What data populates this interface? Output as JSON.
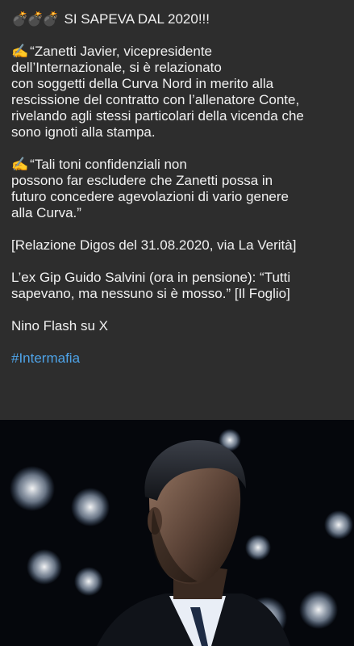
{
  "post": {
    "header": {
      "bombs": "💣💣💣",
      "title": "SI SAPEVA DAL 2020!!!"
    },
    "quote1": {
      "emoji": "✍️",
      "lines": [
        "“Zanetti Javier, vicepresidente",
        "dell’Internazionale, si è relazionato",
        "con soggetti della Curva Nord in merito alla",
        "rescissione del contratto con l’allenatore Conte,",
        "rivelando agli stessi particolari della vicenda che",
        "sono ignoti alla stampa."
      ]
    },
    "quote2": {
      "emoji": "✍️",
      "lines": [
        "“Tali toni confidenziali non",
        "possono far escludere che Zanetti possa in",
        "futuro concedere agevolazioni di vario genere",
        "alla Curva.”"
      ]
    },
    "source": "[Relazione Digos del 31.08.2020, via La Verità]",
    "gip": [
      "L’ex Gip Guido Salvini (ora in pensione): “Tutti",
      "sapevano, ma nessuno si è mosso.” [Il Foglio]"
    ],
    "author": "Nino Flash su X",
    "hashtag": "#Intermafia"
  },
  "colors": {
    "background": "#2d2d2d",
    "text": "#f1f1f1",
    "link": "#4ea3e8"
  }
}
